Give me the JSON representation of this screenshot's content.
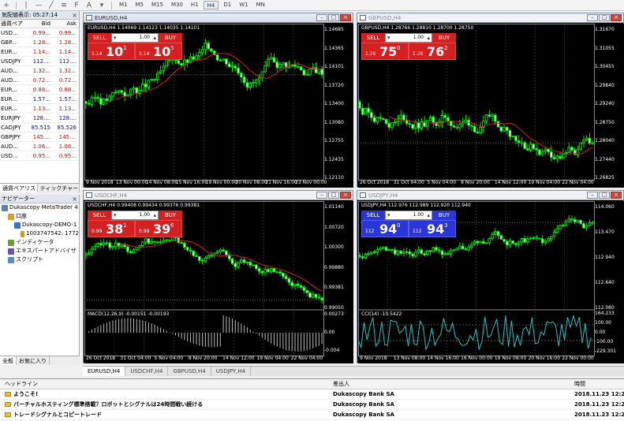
{
  "toolbar": {
    "timeframes": [
      "M1",
      "M5",
      "M15",
      "M30",
      "H1",
      "H4",
      "D1",
      "W1",
      "MN"
    ],
    "active_timeframe": "H4"
  },
  "market_watch": {
    "title": "気配値表示: 05:27:14",
    "headers": [
      "通貨ペア",
      "Bid",
      "Ask"
    ],
    "rows": [
      {
        "sym": "USD...",
        "bid": "0.99...",
        "ask": "0.99...",
        "color": "red"
      },
      {
        "sym": "GBP...",
        "bid": "1.28...",
        "ask": "1.28...",
        "color": "red"
      },
      {
        "sym": "EUR...",
        "bid": "1.14...",
        "ask": "1.14...",
        "color": "red"
      },
      {
        "sym": "USDJPY",
        "bid": "112....",
        "ask": "112....",
        "color": "blue"
      },
      {
        "sym": "AUD...",
        "bid": "1.32...",
        "ask": "1.32...",
        "color": "red"
      },
      {
        "sym": "AUD...",
        "bid": "0.72...",
        "ask": "0.72...",
        "color": "red"
      },
      {
        "sym": "EUR...",
        "bid": "0.88...",
        "ask": "0.88...",
        "color": "red"
      },
      {
        "sym": "EUR...",
        "bid": "1.57...",
        "ask": "1.57...",
        "color": "blue"
      },
      {
        "sym": "EUR...",
        "bid": "1.13...",
        "ask": "1.13...",
        "color": "red"
      },
      {
        "sym": "EURJPY",
        "bid": "128....",
        "ask": "128....",
        "color": "blue"
      },
      {
        "sym": "CADJPY",
        "bid": "85.515",
        "ask": "85.526",
        "color": "blue"
      },
      {
        "sym": "GBPJPY",
        "bid": "145....",
        "ask": "145....",
        "color": "red"
      },
      {
        "sym": "AUD...",
        "bid": "1.06...",
        "ask": "1.06...",
        "color": "red"
      },
      {
        "sym": "USD...",
        "bid": "0.95...",
        "ask": "0.95...",
        "color": "red"
      }
    ],
    "tabs": [
      "通貨ペアリスト",
      "ティックチャート"
    ]
  },
  "navigator": {
    "title": "ナビゲーター",
    "items": [
      {
        "label": "Dukascopy MetaTrader 4",
        "indent": 0
      },
      {
        "label": "口座",
        "indent": 1
      },
      {
        "label": "Dukascopy-DEMO-1",
        "indent": 2
      },
      {
        "label": "1003747542: 1772",
        "indent": 3
      },
      {
        "label": "インディケータ",
        "indent": 1
      },
      {
        "label": "エキスパートアドバイザ",
        "indent": 1
      },
      {
        "label": "スクリプト",
        "indent": 1
      }
    ],
    "tabs": [
      "全般",
      "お気に入り"
    ]
  },
  "charts": [
    {
      "id": "eurusd",
      "title": "EURUSD,H4",
      "active": true,
      "info": "EURUSD,H4  1.14069 1.14123 1.14035 1.14101",
      "sell": {
        "label": "SELL",
        "small": "1.14",
        "big": "10",
        "sup": "1"
      },
      "buy": {
        "label": "BUY",
        "small": "1.14",
        "big": "10",
        "sup": "5"
      },
      "lots": "1.00",
      "price_labels": [
        "1.14685",
        "1.14365",
        "1.14101",
        "1.13720",
        "1.13400",
        "1.13080",
        "1.12755",
        "1.12435",
        "1.12110"
      ],
      "x_labels": [
        "9 Nov 2018",
        "13 Nov 00:00",
        "14 Nov 08:00",
        "15 Nov 16:00",
        "19 Nov 00:00",
        "20 Nov 08:00",
        "21 Nov 16:00",
        "23 Nov 00:00"
      ],
      "color": "red"
    },
    {
      "id": "gbpusd",
      "title": "GBPUSD,H4",
      "active": false,
      "info": "GBPUSD,H4  1.28766 1.28810 1.28700 1.28750",
      "sell": {
        "label": "SELL",
        "small": "1.28",
        "big": "75",
        "sup": "0"
      },
      "buy": {
        "label": "BUY",
        "small": "1.28",
        "big": "76",
        "sup": "2"
      },
      "lots": "1.00",
      "price_labels": [
        "1.31670",
        "1.31055",
        "1.30455",
        "1.29840",
        "1.29240",
        "1.28750",
        "1.28040",
        "1.27440",
        "1.26825"
      ],
      "x_labels": [
        "26 Oct 2018",
        "31 Oct 04:00",
        "5 Nov 04:00",
        "8 Nov 20:00",
        "14 Nov 12:00",
        "19 Nov 04:00",
        "22 Nov 04:00"
      ],
      "color": "red"
    },
    {
      "id": "usdchf",
      "title": "USDCHF,H4",
      "active": false,
      "info": "USDCHF,H4  0.99408 0.99434 0.99376 0.99381",
      "sell": {
        "label": "SELL",
        "small": "0.99",
        "big": "38",
        "sup": "1"
      },
      "buy": {
        "label": "BUY",
        "small": "0.99",
        "big": "39",
        "sup": "6"
      },
      "lots": "1.00",
      "price_labels": [
        "1.01140",
        "1.00720",
        "1.00300",
        "0.99880",
        "0.99381",
        "0.99050"
      ],
      "macd_label": "MACD(12,26,9) -0.00151 -0.00193",
      "macd_labels": [
        "0.00273",
        "0.00",
        "-0.004"
      ],
      "x_labels": [
        "26 Oct 2018",
        "31 Oct 04:00",
        "5 Nov 04:00",
        "8 Nov 20:00",
        "14 Nov 12:00",
        "19 Nov 04:00",
        "22 Nov 04:00"
      ],
      "color": "red"
    },
    {
      "id": "usdjpy",
      "title": "USDJPY,H4",
      "active": false,
      "info": "USDJPY,H4  112.976 112.989 112.920 112.940",
      "sell": {
        "label": "SELL",
        "small": "112",
        "big": "94",
        "sup": "0"
      },
      "buy": {
        "label": "BUY",
        "small": "112",
        "big": "94",
        "sup": "3"
      },
      "lots": "1.00",
      "price_labels": [
        "114.060",
        "113.470",
        "112.940",
        "112.640",
        "112.080"
      ],
      "cci_label": "CCI(14) -10.5422",
      "cci_labels": [
        "164.233",
        "100.00",
        "0.00",
        "-100.00",
        "-229.301"
      ],
      "x_labels": [
        "9 Nov 2018",
        "13 Nov 08:00",
        "14 Nov 16:00",
        "16 Nov 00:00",
        "19 Nov 08:00",
        "20 Nov 16:00",
        "22 Nov 00:00"
      ],
      "color": "blue"
    }
  ],
  "chart_tabs": [
    "EURUSD,H4",
    "USDCHF,H4",
    "GBPUSD,H4",
    "USDJPY,H4"
  ],
  "news": {
    "headers": [
      "ヘッドライン",
      "差出人",
      "時間"
    ],
    "rows": [
      {
        "title": "ようこそ!",
        "from": "Dukascopy Bank SA",
        "time": "2018.11.23 12:21"
      },
      {
        "title": "バーチャルホスティング標準搭載？ロボットとシグナルは24時間戦い続ける",
        "from": "Dukascopy Bank SA",
        "time": "2018.11.23 12:21"
      },
      {
        "title": "トレードシグナルとコピートレード",
        "from": "Dukascopy Bank SA",
        "time": "2018.11.23 12:21"
      }
    ]
  }
}
